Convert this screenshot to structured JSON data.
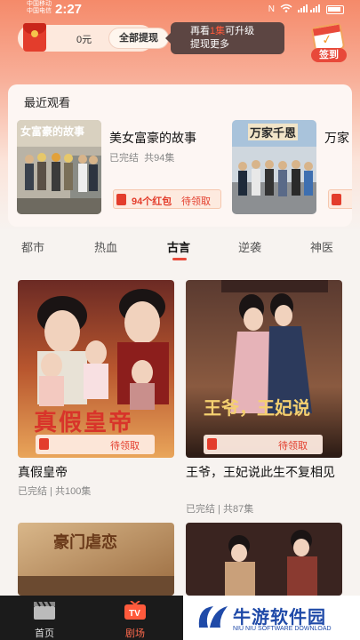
{
  "status_bar": {
    "carrier_1": "中国移动",
    "carrier_2": "中国电信",
    "time": "2:27",
    "signal_text": "5G 4G",
    "icon_names": [
      "nfc-icon",
      "wifi-icon",
      "signal-icon",
      "battery-icon"
    ]
  },
  "wallet": {
    "balance": "0元",
    "withdraw_label": "全部提现"
  },
  "tip": {
    "line1_prefix": "再看",
    "line1_highlight": "1集",
    "line1_suffix": "可升级",
    "line2": "提现更多"
  },
  "checkin": {
    "label": "签到"
  },
  "recent": {
    "title": "最近观看",
    "items": [
      {
        "title": "美女富豪的故事",
        "status": "已完结",
        "episodes": "共94集",
        "reward_count": "94个红包",
        "reward_status": "待领取",
        "poster_text": "女富豪的故事"
      },
      {
        "title": "万家",
        "poster_text": "万家千恩"
      }
    ]
  },
  "tabs": [
    "都市",
    "热血",
    "古言",
    "逆袭",
    "神医"
  ],
  "active_tab": "古言",
  "grid": [
    {
      "title": "真假皇帝",
      "status": "已完结",
      "episodes": "共100集",
      "reward_status": "待领取",
      "poster_text": "真假皇帝"
    },
    {
      "title": "王爷，王妃说此生不复相见",
      "status": "已完结",
      "episodes": "共87集",
      "reward_status": "待领取",
      "poster_text": "王爷，王妃说"
    },
    {
      "poster_text": "豪门虐恋"
    },
    {
      "poster_text": ""
    }
  ],
  "bottom_nav": [
    {
      "label": "首页",
      "icon": "clapperboard-icon"
    },
    {
      "label": "剧场",
      "icon": "tv-icon"
    }
  ],
  "watermark": {
    "main": "牛游软件园",
    "sub": "NIU NIU SOFTWARE DOWNLOAD"
  },
  "colors": {
    "accent": "#e8493a",
    "header_gradient_top": "#f58a6a",
    "nav_bg": "#1b1b1b",
    "watermark_blue": "#1f4aa8"
  }
}
